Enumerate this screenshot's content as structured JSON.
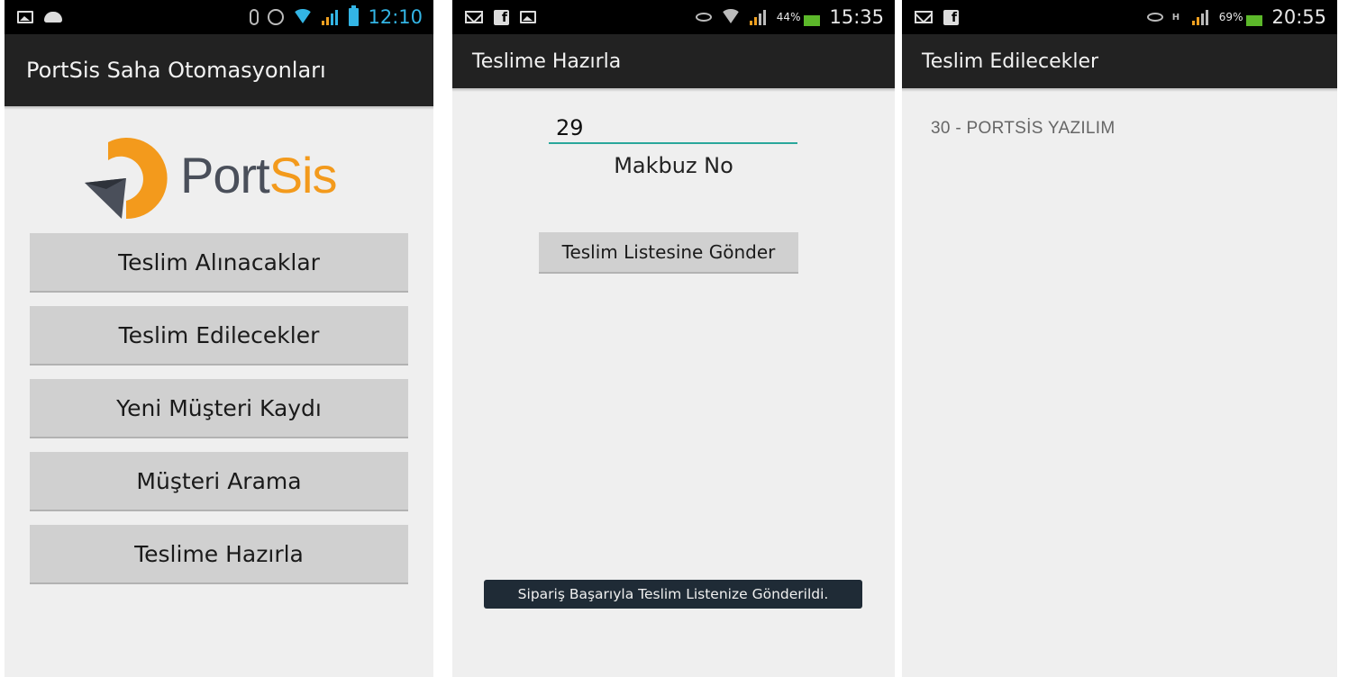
{
  "screen1": {
    "status_time": "12:10",
    "title": "PortSis Saha Otomasyonları",
    "logo": {
      "text_a": "Port",
      "text_b": "Sis"
    },
    "buttons": [
      {
        "label": "Teslim Alınacaklar"
      },
      {
        "label": "Teslim Edilecekler"
      },
      {
        "label": "Yeni Müşteri Kaydı"
      },
      {
        "label": "Müşteri Arama"
      },
      {
        "label": "Teslime Hazırla"
      }
    ]
  },
  "screen2": {
    "status_time": "15:35",
    "battery_pct": "44%",
    "title": "Teslime Hazırla",
    "receipt_value": "29",
    "receipt_label": "Makbuz No",
    "send_button": "Teslim Listesine Gönder",
    "toast": "Sipariş Başarıyla Teslim Listenize Gönderildi."
  },
  "screen3": {
    "status_time": "20:55",
    "battery_pct": "69%",
    "network": "H",
    "title": "Teslim Edilecekler",
    "items": [
      {
        "label": "30 - PORTSİS YAZILIM"
      }
    ]
  },
  "colors": {
    "accent_blue": "#33b5e5",
    "logo_orange": "#f39a1c",
    "logo_gray": "#4a4f5a",
    "input_underline": "#2aa79b",
    "toast_bg": "#1f2b36"
  }
}
